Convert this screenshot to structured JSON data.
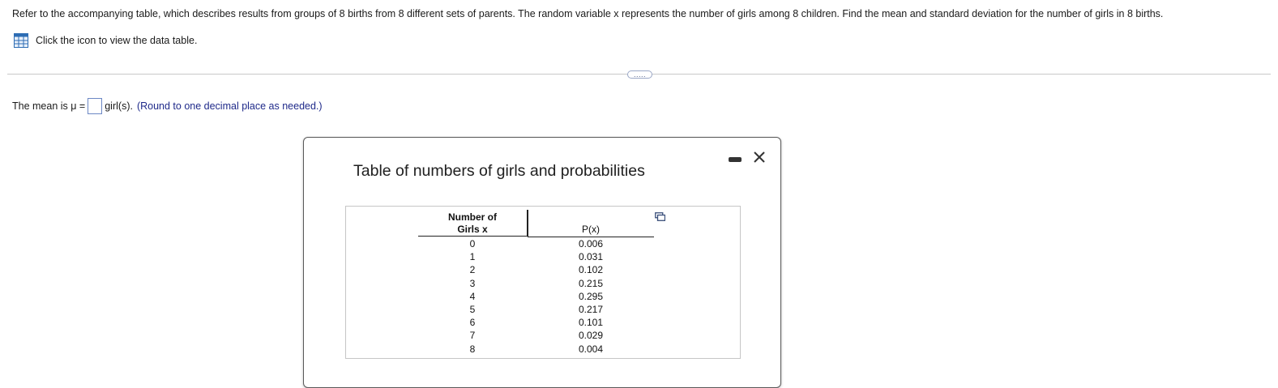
{
  "question": {
    "text": "Refer to the accompanying table, which describes results from groups of 8 births from 8 different sets of parents. The random variable x represents the number of girls among 8 children. Find the mean and standard deviation for the number of girls in 8 births."
  },
  "table_link": {
    "icon": "data-table-icon",
    "text": "Click the icon to view the data table."
  },
  "expand_button": {
    "label": "....."
  },
  "answer": {
    "prefix": "The mean is μ =",
    "input_value": "",
    "unit": "girl(s).",
    "hint": "(Round to one decimal place as needed.)"
  },
  "dialog": {
    "title": "Table of numbers of girls and probabilities",
    "minimize_icon": "minimize-icon",
    "close_icon": "close-icon",
    "copy_icon": "copy-icon",
    "table": {
      "header_x_line1": "Number of",
      "header_x_line2": "Girls x",
      "header_p": "P(x)",
      "rows": [
        {
          "x": "0",
          "p": "0.006"
        },
        {
          "x": "1",
          "p": "0.031"
        },
        {
          "x": "2",
          "p": "0.102"
        },
        {
          "x": "3",
          "p": "0.215"
        },
        {
          "x": "4",
          "p": "0.295"
        },
        {
          "x": "5",
          "p": "0.217"
        },
        {
          "x": "6",
          "p": "0.101"
        },
        {
          "x": "7",
          "p": "0.029"
        },
        {
          "x": "8",
          "p": "0.004"
        }
      ]
    }
  },
  "colors": {
    "hint_text": "#1f2a8a",
    "icon_blue": "#2e6db4",
    "input_border": "#6c88c4"
  }
}
